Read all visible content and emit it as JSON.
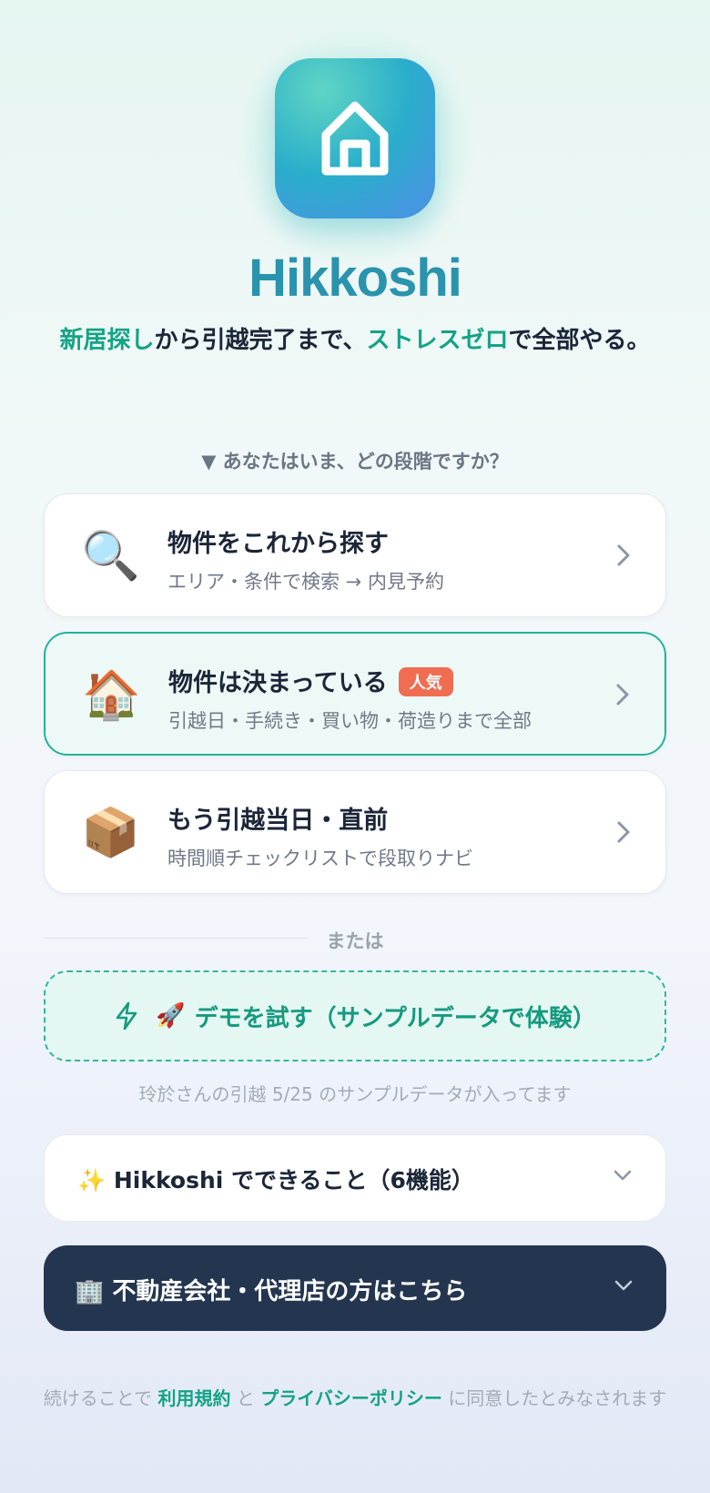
{
  "app": {
    "name": "Hikkoshi",
    "tagline_parts": [
      "新居探し",
      "から引越完了まで、",
      "ストレスゼロ",
      "で全部やる。"
    ]
  },
  "stage_question": "▼ あなたはいま、どの段階ですか？",
  "stages": [
    {
      "emoji": "🔍",
      "icon": "magnifier-icon",
      "title": "物件をこれから探す",
      "subtitle": "エリア・条件で検索 → 内見予約"
    },
    {
      "emoji": "🏠",
      "icon": "house-icon",
      "title": "物件は決まっている",
      "badge": "人気",
      "subtitle": "引越日・手続き・買い物・荷造りまで全部",
      "selected": true
    },
    {
      "emoji": "📦",
      "icon": "package-icon",
      "title": "もう引越当日・直前",
      "subtitle": "時間順チェックリストで段取りナビ"
    }
  ],
  "divider_label": "または",
  "demo": {
    "rocket": "🚀",
    "label": "デモを試す（サンプルデータで体験）",
    "note": "玲於さんの引越 5/25 のサンプルデータが入ってます"
  },
  "features": {
    "label": "✨ Hikkoshi でできること（6機能）"
  },
  "agency": {
    "label": "🏢 不動産会社・代理店の方はこちら"
  },
  "legal": {
    "before": "続けることで ",
    "terms": "利用規約",
    "middle": " と ",
    "privacy": "プライバシーポリシー",
    "after": " に同意したとみなされます"
  },
  "colors": {
    "accent": "#14a385",
    "badge": "#f06d52",
    "dark_panel": "#243550",
    "brand": "#2a93ad"
  }
}
